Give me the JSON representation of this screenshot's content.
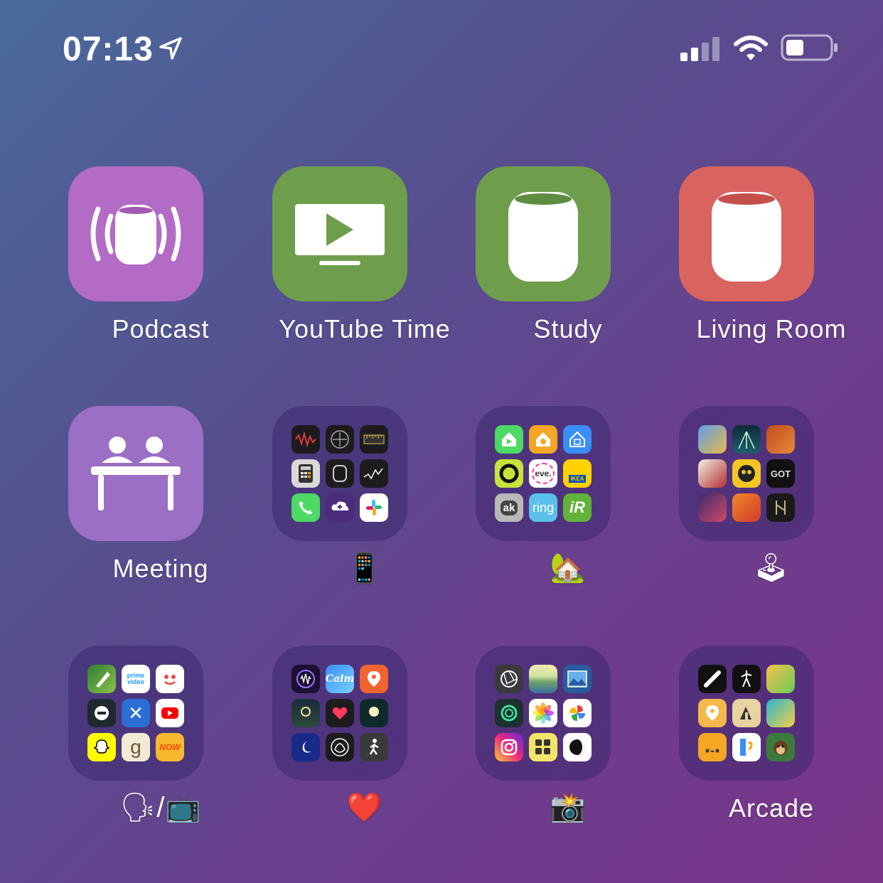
{
  "status_bar": {
    "time": "07:13"
  },
  "shortcuts": [
    {
      "label": "Podcast",
      "color": "#b36bc6"
    },
    {
      "label": "YouTube Time",
      "color": "#6e9e4c"
    },
    {
      "label": "Study",
      "color": "#6e9e4c"
    },
    {
      "label": "Living Room",
      "color": "#d9635f"
    },
    {
      "label": "Meeting",
      "color": "#9a6fc4"
    }
  ],
  "folders": [
    {
      "label": "📱",
      "apps": [
        "Voice Memos",
        "Compass",
        "Measure",
        "Calculator",
        "Watch",
        "Stocks",
        "Phone",
        "Cloud",
        "Slack"
      ]
    },
    {
      "label": "🏡",
      "apps": [
        "Home",
        "Home Hub",
        "HomeKit",
        "Circle",
        "eve.",
        "IKEA",
        "ak",
        "ring",
        "iR"
      ]
    },
    {
      "label": "🕹",
      "apps": [
        "Game 1",
        "Game 2",
        "Game 3",
        "Game 4",
        "Game 5",
        "GOT",
        "Game 7",
        "Game 8",
        "Game 9"
      ]
    },
    {
      "label": "🗣/📺",
      "apps": [
        "Stylus",
        "prime video",
        "Face",
        "Echo",
        "Xmark",
        "YouTube",
        "Snapchat",
        "g",
        "NOW"
      ]
    },
    {
      "label": "❤️",
      "apps": [
        "Sound",
        "Calm",
        "Pin",
        "Night",
        "Heart",
        "Moon",
        "Sleep",
        "Breathe",
        "Walk"
      ]
    },
    {
      "label": "📸",
      "apps": [
        "Aperture",
        "Landscape",
        "Photo Frame",
        "Halide",
        "Photos",
        "Google Photos",
        "Instagram",
        "Filters",
        "Darkroom"
      ]
    },
    {
      "label": " Arcade",
      "apps": [
        "Skate",
        "Figure",
        "Frog",
        "Pin",
        "Tools",
        "Pilot",
        "Face",
        "Bookmark",
        "Monkey"
      ]
    }
  ],
  "mini_text": {
    "prime": "prime video",
    "eve": "eve.",
    "ikea": "IKEA",
    "ak": "ak",
    "ring": "ring",
    "ir": "iR",
    "got": "GOT",
    "g": "g",
    "now": "NOW",
    "calm": "Calm"
  }
}
